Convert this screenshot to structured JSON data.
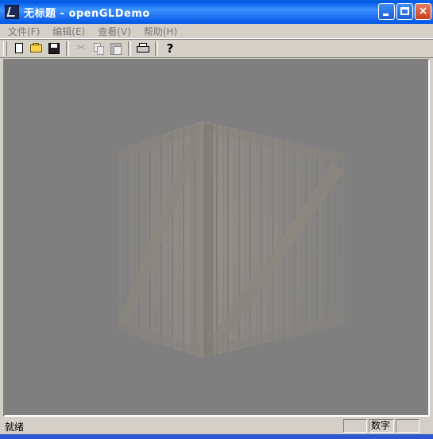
{
  "window": {
    "title": "无标题 - openGLDemo",
    "buttons": {
      "minimize": "minimize",
      "maximize": "maximize",
      "close": "×"
    }
  },
  "menu": {
    "items": [
      {
        "label": "文件(F)"
      },
      {
        "label": "编辑(E)"
      },
      {
        "label": "查看(V)"
      },
      {
        "label": "帮助(H)"
      }
    ]
  },
  "toolbar": {
    "buttons": [
      {
        "name": "new",
        "icon": "new-document-icon",
        "enabled": true
      },
      {
        "name": "open",
        "icon": "folder-open-icon",
        "enabled": true
      },
      {
        "name": "save",
        "icon": "floppy-disk-icon",
        "enabled": true
      },
      {
        "name": "cut",
        "icon": "scissors-icon",
        "enabled": false
      },
      {
        "name": "copy",
        "icon": "copy-icon",
        "enabled": false
      },
      {
        "name": "paste",
        "icon": "paste-icon",
        "enabled": false
      },
      {
        "name": "print",
        "icon": "printer-icon",
        "enabled": true
      },
      {
        "name": "help",
        "icon": "help-question-icon",
        "enabled": true
      }
    ],
    "help_glyph": "?"
  },
  "viewport": {
    "scene": "textured wooden crate in fog",
    "background_color": "#7f7f7f"
  },
  "statusbar": {
    "text": "就绪",
    "panes": [
      "",
      "数字",
      ""
    ]
  }
}
